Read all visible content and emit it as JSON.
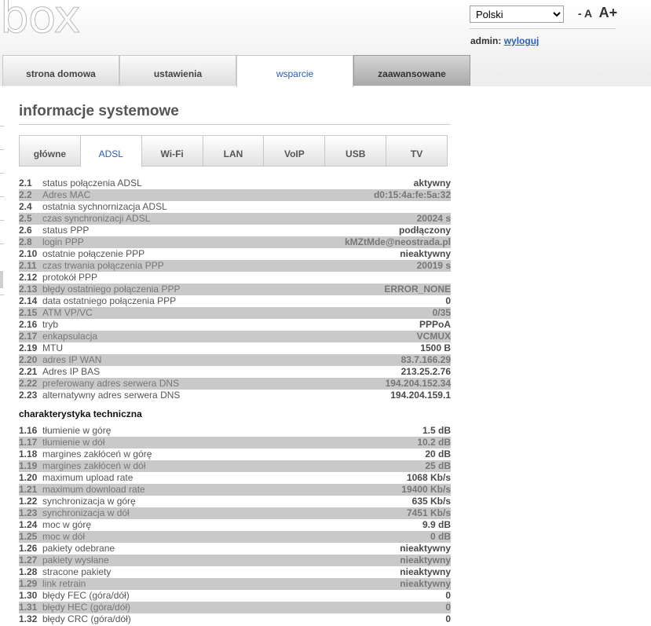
{
  "header": {
    "logo": "box",
    "language": "Polski",
    "font_minus": "- A",
    "font_plus": "A+",
    "admin_label": "admin:",
    "logout": "wyloguj"
  },
  "main_tabs": [
    "strona domowa",
    "ustawienia",
    "wsparcie",
    "zaawansowane"
  ],
  "page": {
    "title": "informacje systemowe",
    "subheading": "charakterystyka techniczna"
  },
  "sub_tabs": [
    "główne",
    "ADSL",
    "Wi-Fi",
    "LAN",
    "VoIP",
    "USB",
    "TV"
  ],
  "adsl_rows": [
    {
      "num": "2.1",
      "label": "status połączenia ADSL",
      "value": "aktywny"
    },
    {
      "num": "2.2",
      "label": "Adres MAC",
      "value": "d0:15:4a:fe:5a:32"
    },
    {
      "num": "2.4",
      "label": "ostatnia sychnornizacja ADSL",
      "value": ""
    },
    {
      "num": "2.5",
      "label": "czas synchronizacji ADSL",
      "value": "20024 s"
    },
    {
      "num": "2.6",
      "label": "status PPP",
      "value": "podłączony"
    },
    {
      "num": "2.8",
      "label": "login PPP",
      "value": "kMZtMde@neostrada.pl"
    },
    {
      "num": "2.10",
      "label": "ostatnie połączenie PPP",
      "value": "nieaktywny"
    },
    {
      "num": "2.11",
      "label": "czas trwania połączenia PPP",
      "value": "20019 s"
    },
    {
      "num": "2.12",
      "label": "protokół PPP",
      "value": ""
    },
    {
      "num": "2.13",
      "label": "błędy ostatniego połączenia PPP",
      "value": "ERROR_NONE"
    },
    {
      "num": "2.14",
      "label": "data ostatniego połączenia PPP",
      "value": "0"
    },
    {
      "num": "2.15",
      "label": "ATM VP/VC",
      "value": "0/35"
    },
    {
      "num": "2.16",
      "label": "tryb",
      "value": "PPPoA"
    },
    {
      "num": "2.17",
      "label": "enkapsulacja",
      "value": "VCMUX"
    },
    {
      "num": "2.19",
      "label": "MTU",
      "value": "1500 B"
    },
    {
      "num": "2.20",
      "label": "adres IP WAN",
      "value": "83.7.166.29"
    },
    {
      "num": "2.21",
      "label": "Adres IP BAS",
      "value": "213.25.2.76"
    },
    {
      "num": "2.22",
      "label": "preferowany adres serwera DNS",
      "value": "194.204.152.34"
    },
    {
      "num": "2.23",
      "label": "alternatywny adres serwera DNS",
      "value": "194.204.159.1"
    }
  ],
  "tech_rows": [
    {
      "num": "1.16",
      "label": "tłumienie w górę",
      "value": "1.5 dB"
    },
    {
      "num": "1.17",
      "label": "tłumienie w dół",
      "value": "10.2 dB"
    },
    {
      "num": "1.18",
      "label": "margines zakłóceń w górę",
      "value": "20 dB"
    },
    {
      "num": "1.19",
      "label": "margines zakłóceń w dół",
      "value": "25 dB"
    },
    {
      "num": "1.20",
      "label": "maximum upload rate",
      "value": "1068 Kb/s"
    },
    {
      "num": "1.21",
      "label": "maximum download rate",
      "value": "19400 Kb/s"
    },
    {
      "num": "1.22",
      "label": "synchronizacja w górę",
      "value": "635 Kb/s"
    },
    {
      "num": "1.23",
      "label": "synchronizacja w dół",
      "value": "7451 Kb/s"
    },
    {
      "num": "1.24",
      "label": "moc w górę",
      "value": "9.9 dB"
    },
    {
      "num": "1.25",
      "label": "moc w dół",
      "value": "0 dB"
    },
    {
      "num": "1.26",
      "label": "pakiety odebrane",
      "value": "nieaktywny"
    },
    {
      "num": "1.27",
      "label": "pakiety wysłane",
      "value": "nieaktywny"
    },
    {
      "num": "1.28",
      "label": "stracone pakiety",
      "value": "nieaktywny"
    },
    {
      "num": "1.29",
      "label": "link retrain",
      "value": "nieaktywny"
    },
    {
      "num": "1.30",
      "label": "błędy FEC (góra/dół)",
      "value": "0"
    },
    {
      "num": "1.31",
      "label": "błędy HEC (góra/dół)",
      "value": "0"
    },
    {
      "num": "1.32",
      "label": "błędy CRC (góra/dół)",
      "value": "0"
    }
  ]
}
